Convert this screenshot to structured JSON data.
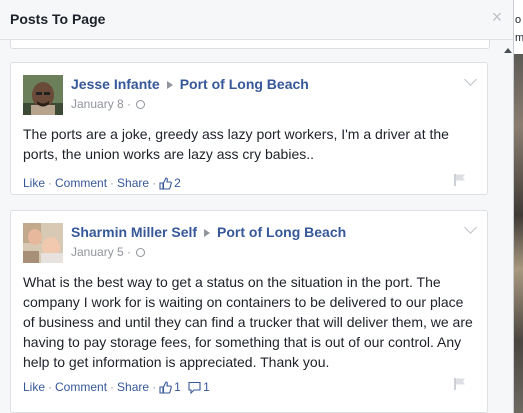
{
  "modal": {
    "title": "Posts To Page"
  },
  "posts": [
    {
      "author": "Jesse Infante",
      "page": "Port of Long Beach",
      "date": "January 8",
      "dot": "·",
      "text": "The ports are a joke, greedy ass lazy port workers, I'm a driver at the ports, the union works are lazy ass cry babies..",
      "actions": {
        "like": "Like",
        "comment": "Comment",
        "share": "Share",
        "sep": "·"
      },
      "likes": "2"
    },
    {
      "author": "Sharmin Miller Self",
      "page": "Port of Long Beach",
      "date": "January 5",
      "dot": "·",
      "text": "What is the best way to get a status on the situation in the port. The company I work for is waiting on containers to be delivered to our place of business and until they can find a trucker that will deliver them, we are having to pay storage fees, for something that is out of our control. Any help to get information is appreciated. Thank you.",
      "actions": {
        "like": "Like",
        "comment": "Comment",
        "share": "Share",
        "sep": "·"
      },
      "likes": "1",
      "comments": "1"
    }
  ],
  "edge": {
    "t1": "o",
    "t2": "m"
  },
  "colors": {
    "link": "#365899",
    "text": "#1d2129",
    "meta": "#90949c"
  }
}
